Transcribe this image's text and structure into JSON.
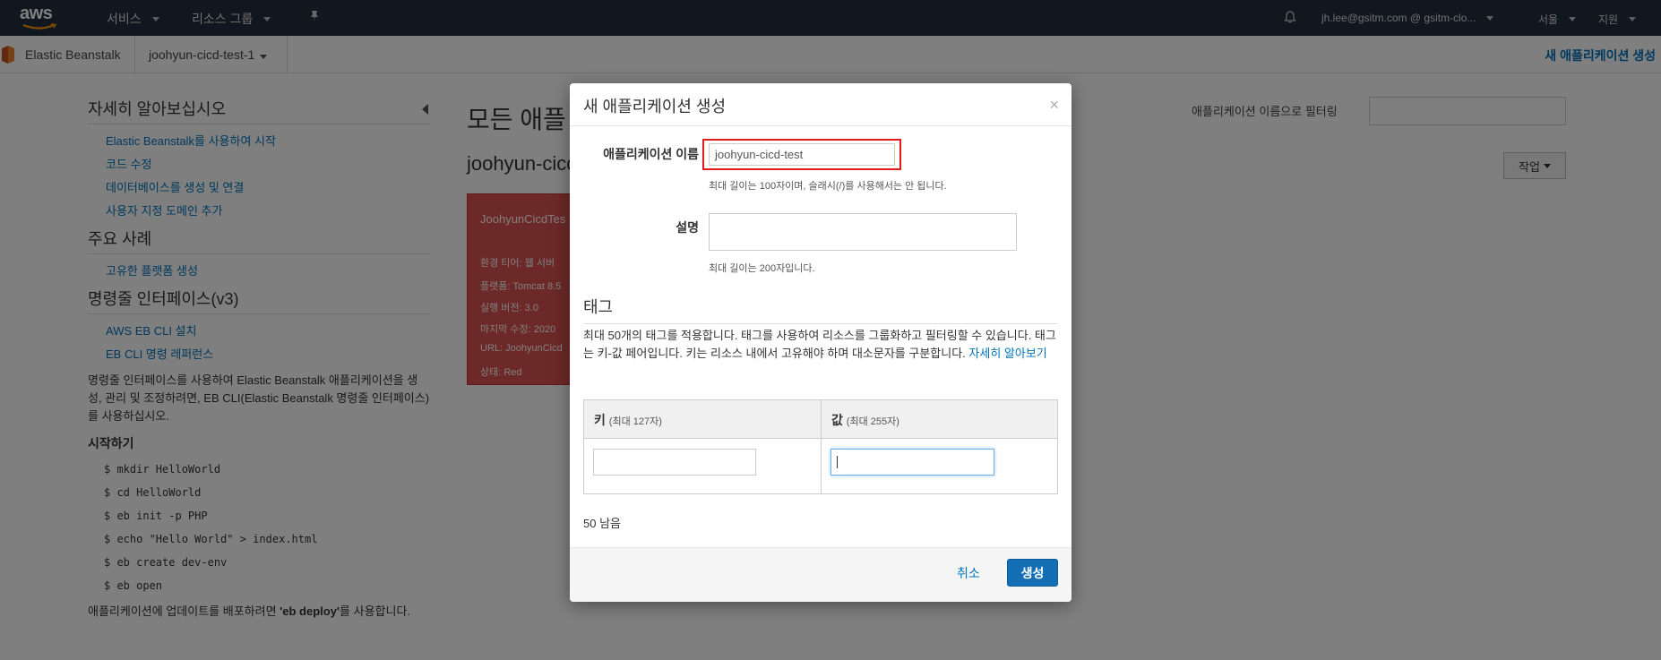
{
  "topnav": {
    "logo_text": "aws",
    "services": "서비스",
    "resource_groups": "리소스 그룹",
    "pin_icon": "pin-icon",
    "bell_icon": "bell-icon",
    "account": "jh.lee@gsitm.com @ gsitm-clo...",
    "region": "서울",
    "support": "지원"
  },
  "subbar": {
    "service": "Elastic Beanstalk",
    "app_selector": "joohyun-cicd-test-1",
    "create_app_link": "새 애플리케이션 생성"
  },
  "sidebar": {
    "learn_heading": "자세히 알아보십시오",
    "learn_links": [
      "Elastic Beanstalk를 사용하여 시작",
      "코드 수정",
      "데이터베이스를 생성 및 연결",
      "사용자 지정 도메인 추가"
    ],
    "cases_heading": "주요 사례",
    "cases_links": [
      "고유한 플랫폼 생성"
    ],
    "cli_heading": "명령줄 인터페이스(v3)",
    "cli_links": [
      "AWS EB CLI 설치",
      "EB CLI 명령 레퍼런스"
    ],
    "cli_desc": "명령줄 인터페이스를 사용하여 Elastic Beanstalk 애플리케이션을 생성, 관리 및 조정하려면, EB CLI(Elastic Beanstalk 명령줄 인터페이스)를 사용하십시오.",
    "start_heading": "시작하기",
    "commands": [
      "$ mkdir HelloWorld",
      "$ cd HelloWorld",
      "$ eb init -p PHP",
      "$ echo \"Hello World\" > index.html",
      "$ eb create dev-env",
      "$ eb open"
    ],
    "deploy_pre": "애플리케이션에 업데이트를 배포하려면 ",
    "deploy_cmd": "'eb deploy'",
    "deploy_post": "를 사용합니다."
  },
  "main": {
    "title": "모든 애플",
    "subtitle": "joohyun-cicd",
    "filter_label": "애플리케이션 이름으로 필터링",
    "action_button": "작업",
    "env_card": {
      "name": "JoohyunCicdTes",
      "rows": [
        "환경 티어: 웹 서버",
        "플랫폼: Tomcat 8.5",
        "실행 버전: 3.0",
        "마지막 수정: 2020",
        "URL: JoohyunCicd",
        "상태: Red"
      ]
    }
  },
  "modal": {
    "title": "새 애플리케이션 생성",
    "close_icon": "close-icon",
    "app_name_label": "애플리케이션 이름",
    "app_name_value": "joohyun-cicd-test",
    "app_name_hint": "최대 길이는 100자이며, 슬래시(/)를 사용해서는 안 됩니다.",
    "desc_label": "설명",
    "desc_value": "",
    "desc_hint": "최대 길이는 200자입니다.",
    "tags_heading": "태그",
    "tags_desc": "최대 50개의 태그를 적용합니다. 태그를 사용하여 리소스를 그룹화하고 필터링할 수 있습니다. 태그는 키-값 페어입니다. 키는 리소스 내에서 고유해야 하며 대소문자를 구분합니다.",
    "tags_link": "자세히 알아보기",
    "key_header": "키",
    "key_header_note": "(최대 127자)",
    "value_header": "값",
    "value_header_note": "(최대 255자)",
    "key_value": "",
    "value_value": "",
    "remaining": "50 남음",
    "cancel_label": "취소",
    "create_label": "생성"
  },
  "colors": {
    "nav_bg": "#232f3e",
    "link": "#0073bb",
    "primary_button": "#146eb4",
    "highlight": "#e21b1b",
    "env_red": "#d9534f"
  }
}
